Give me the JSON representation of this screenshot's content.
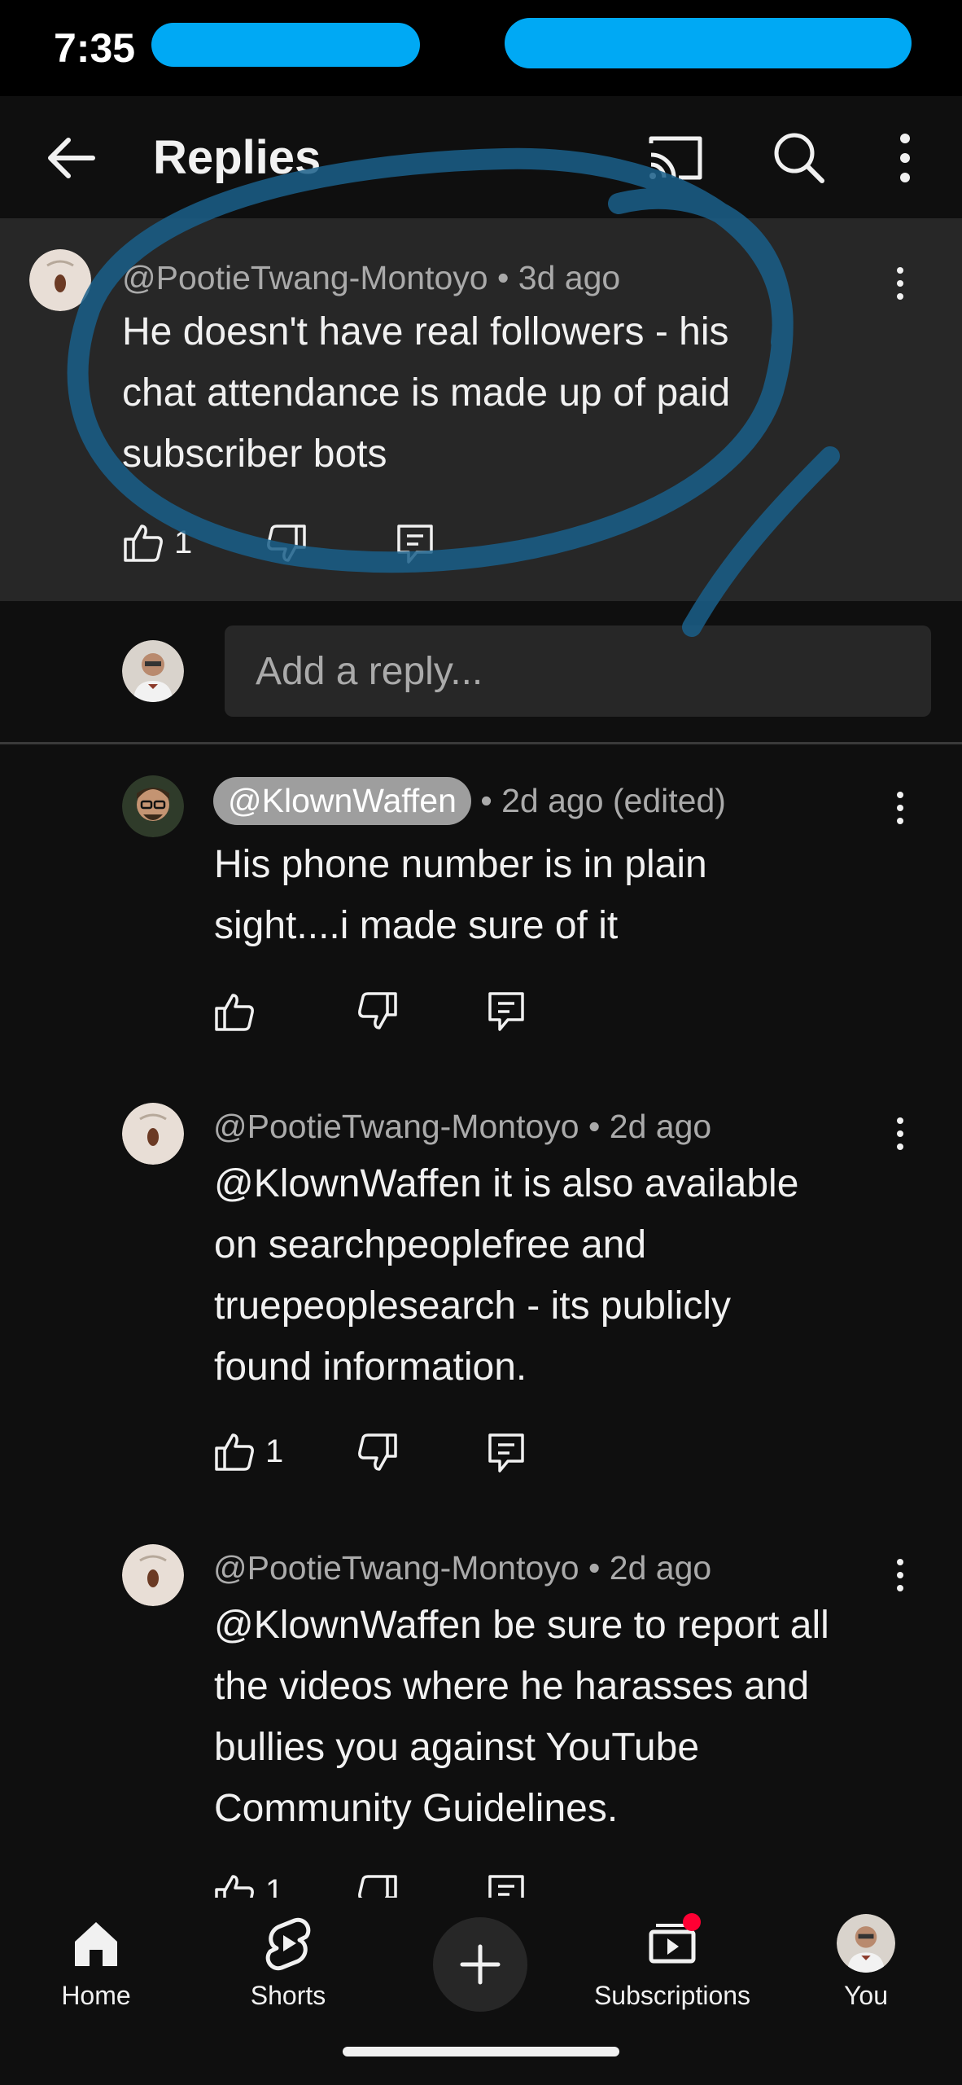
{
  "status_bar": {
    "time": "7:35"
  },
  "app_bar": {
    "title": "Replies",
    "back_icon": "arrow-left-icon",
    "cast_icon": "cast-icon",
    "search_icon": "search-icon",
    "more_icon": "more-vert-icon"
  },
  "parent_comment": {
    "author": "@PootieTwang-Montoyo",
    "time": "3d ago",
    "text_lines": [
      "He doesn't have real followers - his",
      "chat attendance is made up of paid",
      "subscriber bots"
    ],
    "likes": "1"
  },
  "composer": {
    "placeholder": "Add a reply..."
  },
  "replies": [
    {
      "author": "@KlownWaffen",
      "time": "2d ago (edited)",
      "text_lines": [
        "His phone number is in plain",
        "sight....i made sure of it"
      ],
      "likes": ""
    },
    {
      "author": "@PootieTwang-Montoyo",
      "time": "2d ago",
      "text_lines": [
        "@KlownWaffen it is also available",
        "on searchpeoplefree and",
        "truepeoplesearch - its publicly",
        "found information."
      ],
      "likes": "1"
    },
    {
      "author": "@PootieTwang-Montoyo",
      "time": "2d ago",
      "text_lines": [
        "@KlownWaffen be sure to report all",
        "the videos where he harasses and",
        "bullies you against YouTube",
        "Community Guidelines."
      ],
      "likes": "1"
    }
  ],
  "separator": "•",
  "bottom_nav": {
    "home": "Home",
    "shorts": "Shorts",
    "subscriptions": "Subscriptions",
    "you": "You"
  },
  "colors": {
    "background": "#0f0f0f",
    "highlight": "#272727",
    "annotation": "#1a5f8a",
    "redaction": "#00a9f4",
    "notification": "#ff0033"
  }
}
